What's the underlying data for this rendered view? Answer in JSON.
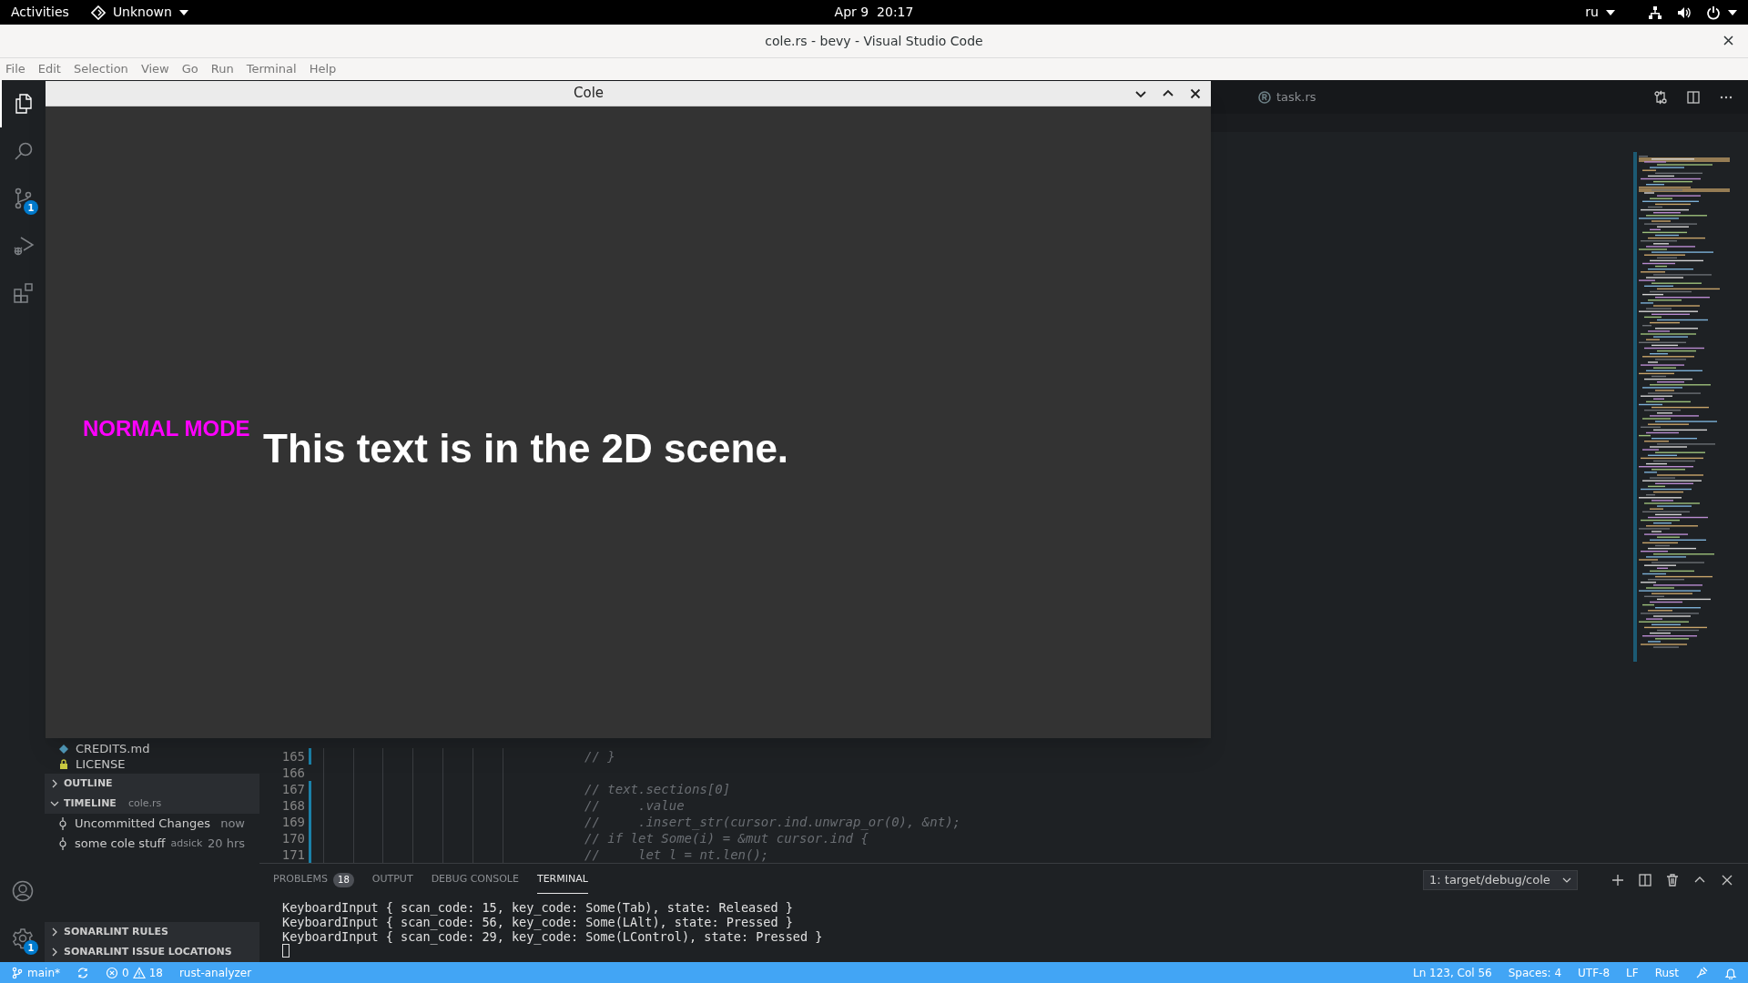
{
  "top_bar": {
    "activities": "Activities",
    "app_menu": "Unknown",
    "clock": "Apr 9  20:17",
    "input_source": "ru"
  },
  "window": {
    "title": "cole.rs - bevy - Visual Studio Code"
  },
  "menu": [
    "File",
    "Edit",
    "Selection",
    "View",
    "Go",
    "Run",
    "Terminal",
    "Help"
  ],
  "activity_bar": [
    {
      "kind": "explorer",
      "selected": true
    },
    {
      "kind": "search",
      "selected": false
    },
    {
      "kind": "source-control",
      "selected": false,
      "badge": "1"
    },
    {
      "kind": "run",
      "selected": false
    },
    {
      "kind": "extensions",
      "selected": false
    }
  ],
  "settings_badge": "1",
  "sidebar": {
    "files": [
      {
        "name": "CREDITS.md",
        "kind": "markdown"
      },
      {
        "name": "LICENSE",
        "kind": "license"
      }
    ],
    "sections": [
      {
        "title": "OUTLINE",
        "expanded": false
      },
      {
        "title": "TIMELINE",
        "subtitle": "cole.rs",
        "expanded": true,
        "items": [
          {
            "label": "Uncommitted Changes",
            "time": "now"
          },
          {
            "label": "some cole stuff",
            "author": "adsick",
            "time": "20 hrs"
          }
        ]
      }
    ],
    "bottom_sections": [
      {
        "title": "SONARLINT RULES",
        "expanded": false
      },
      {
        "title": "SONARLINT ISSUE LOCATIONS",
        "expanded": false
      }
    ]
  },
  "editor": {
    "tabs": [
      {
        "label": "task.rs",
        "selected": false
      }
    ],
    "lines": [
      {
        "number": "165",
        "text": "// }",
        "modified": true
      },
      {
        "number": "166",
        "modified": false
      },
      {
        "number": "167",
        "text": "// text.sections[0]",
        "modified": true
      },
      {
        "number": "168",
        "text": "//     .value",
        "modified": true
      },
      {
        "number": "169",
        "text": "//     .insert_str(cursor.ind.unwrap_or(0), &nt);",
        "modified": true
      },
      {
        "number": "170",
        "text": "// if let Some(i) = &mut cursor.ind {",
        "modified": true
      },
      {
        "number": "171",
        "text": "//     let l = nt.len();",
        "modified": true
      }
    ]
  },
  "panel": {
    "tabs": [
      {
        "label": "PROBLEMS",
        "badge": "18",
        "selected": false
      },
      {
        "label": "OUTPUT",
        "selected": false
      },
      {
        "label": "DEBUG CONSOLE",
        "selected": false
      },
      {
        "label": "TERMINAL",
        "selected": true
      }
    ],
    "terminal_select": "1: target/debug/cole",
    "terminal_lines": [
      "KeyboardInput { scan_code: 15, key_code: Some(Tab), state: Released }",
      "KeyboardInput { scan_code: 56, key_code: Some(LAlt), state: Pressed }",
      "KeyboardInput { scan_code: 29, key_code: Some(LControl), state: Pressed }"
    ]
  },
  "status_bar": {
    "branch": "main*",
    "errors": "0",
    "warnings": "18",
    "language_server": "rust-analyzer",
    "position": "Ln 123, Col 56",
    "indent": "Spaces: 4",
    "encoding": "UTF-8",
    "eol": "LF",
    "language": "Rust"
  },
  "app_window": {
    "title": "Cole",
    "mode": "NORMAL MODE",
    "scene_text": "This text is in the 2D scene."
  }
}
